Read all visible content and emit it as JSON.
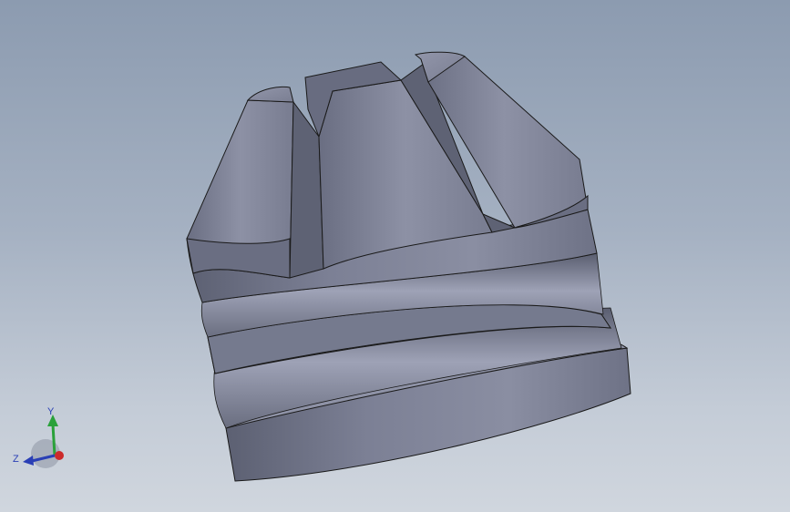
{
  "viewport": {
    "background_top": "#8c9bb0",
    "background_bottom": "#d0d6de"
  },
  "model": {
    "part_color": "#7a7e92",
    "edge_color": "#1a1a1a"
  },
  "triad": {
    "labels": {
      "y": "Y",
      "z": "Z"
    },
    "colors": {
      "x": "#cc2a2a",
      "y": "#2aa13a",
      "z": "#2a3fb5"
    }
  }
}
